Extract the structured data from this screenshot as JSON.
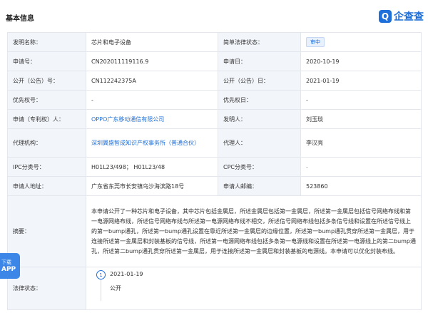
{
  "section_title": "基本信息",
  "brand": {
    "mark": "Q",
    "name": "企查查"
  },
  "rows": {
    "invention_name_label": "发明名称：",
    "invention_name": "芯片和电子设备",
    "legal_status_label": "简单法律状态：",
    "legal_status": "审中",
    "app_no_label": "申请号：",
    "app_no": "CN202011119116.9",
    "app_date_label": "申请日：",
    "app_date": "2020-10-19",
    "pub_no_label": "公开（公告）号：",
    "pub_no": "CN112242375A",
    "pub_date_label": "公开（公告）日：",
    "pub_date": "2021-01-19",
    "priority_no_label": "优先权号：",
    "priority_no": "-",
    "priority_date_label": "优先权日：",
    "priority_date": "-",
    "applicant_label": "申请（专利权）人：",
    "applicant": "OPPO广东移动通信有限公司",
    "inventor_label": "发明人：",
    "inventor": "刘玉琰",
    "agency_label": "代理机构：",
    "agency": "深圳翼盛智成知识产权事务所（普通合伙）",
    "agent_label": "代理人：",
    "agent": "李汉亮",
    "ipc_label": "IPC分类号：",
    "ipc": "H01L23/498； H01L23/48",
    "cpc_label": "CPC分类号：",
    "cpc": "-",
    "address_label": "申请人地址：",
    "address": "广东省东莞市长安镇乌沙海滨路18号",
    "postcode_label": "申请人邮编：",
    "postcode": "523860",
    "abstract_label": "摘要：",
    "abstract": "本申请公开了一种芯片和电子设备，其中芯片包括金属层，所述金属层包括第一金属层，所述第一金属层包括信号网络布线和第一电源网络布线，所述信号网络布线与所述第一电源网络布线不相交，所述信号网络布线包括多条信号线和设置在所述信号线上的第一bump通孔，所述第一bump通孔设置在靠近所述第一金属层的边缘位置，所述第一bump通孔贯穿所述第一金属层，用于连接所述第一金属层和封装基板的信号线，所述第一电源网络布线包括多条第一电源线和设置在所述第一电源线上的第二bump通孔，所述第二bump通孔贯穿所述第一金属层，用于连接所述第一金属层和封装基板的电源线。本申请可以优化封装布线。",
    "legal_label": "法律状态："
  },
  "legal_timeline": [
    {
      "index": "1",
      "date": "2021-01-19",
      "text": "公开"
    }
  ],
  "floating_button": {
    "line1": "下载",
    "line2": "APP"
  },
  "colors": {
    "brand_blue": "#1e6fd9",
    "label_bg": "#f2f5fa",
    "border": "#e3e6ec"
  }
}
